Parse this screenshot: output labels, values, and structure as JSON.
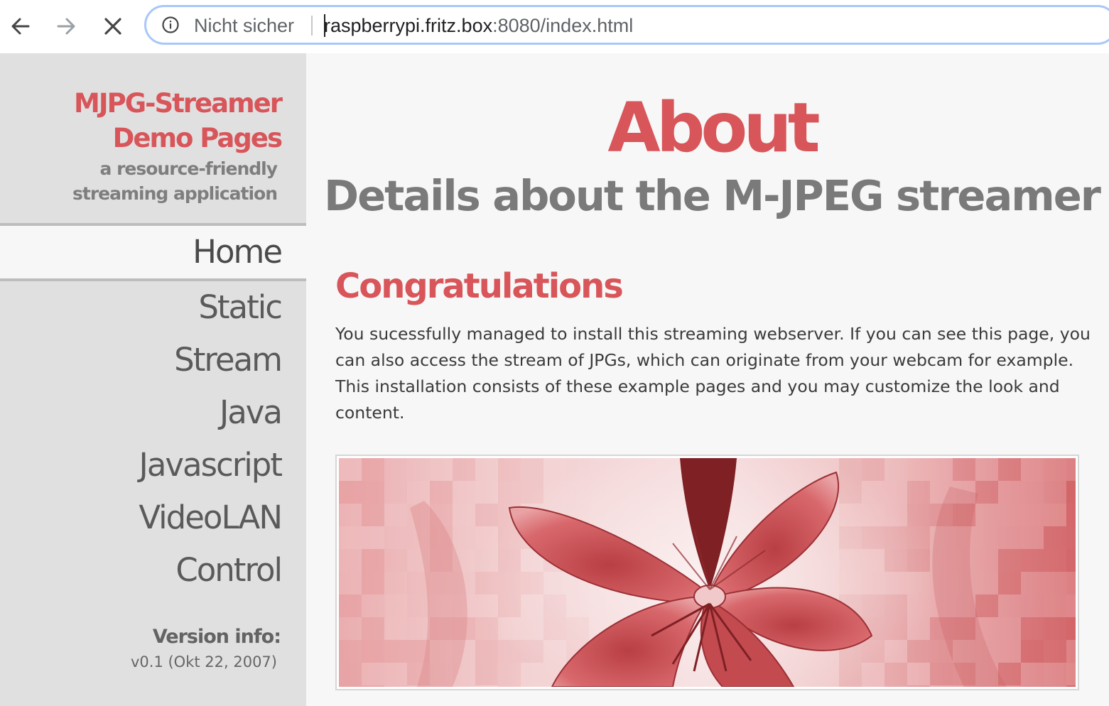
{
  "browser": {
    "security_label": "Nicht sicher",
    "url_host": "raspberrypi.fritz.box",
    "url_path": ":8080/index.html",
    "icons": [
      "back-arrow-icon",
      "forward-arrow-icon",
      "stop-loading-icon",
      "info-icon"
    ]
  },
  "sidebar": {
    "brand_line1": "MJPG-Streamer",
    "brand_line2": "Demo Pages",
    "tagline_line1": "a resource-friendly",
    "tagline_line2": "streaming application",
    "nav": [
      {
        "label": "Home",
        "active": true
      },
      {
        "label": "Static",
        "active": false
      },
      {
        "label": "Stream",
        "active": false
      },
      {
        "label": "Java",
        "active": false
      },
      {
        "label": "Javascript",
        "active": false
      },
      {
        "label": "VideoLAN",
        "active": false
      },
      {
        "label": "Control",
        "active": false
      }
    ],
    "version_title": "Version info:",
    "version_value": "v0.1 (Okt 22, 2007)"
  },
  "main": {
    "title": "About",
    "subtitle": "Details about the M-JPEG streamer",
    "section_heading": "Congratulations",
    "intro": "You sucessfully managed to install this streaming webserver. If you can see this page, you can also access the stream of JPGs, which can originate from your webcam for example. This installation consists of these example pages and you may customize the look and content."
  },
  "colors": {
    "accent": "#d8555a",
    "sidebar_bg": "#e0e0e0",
    "page_bg": "#f7f7f7",
    "omnibox_border": "#a8c7fa"
  }
}
